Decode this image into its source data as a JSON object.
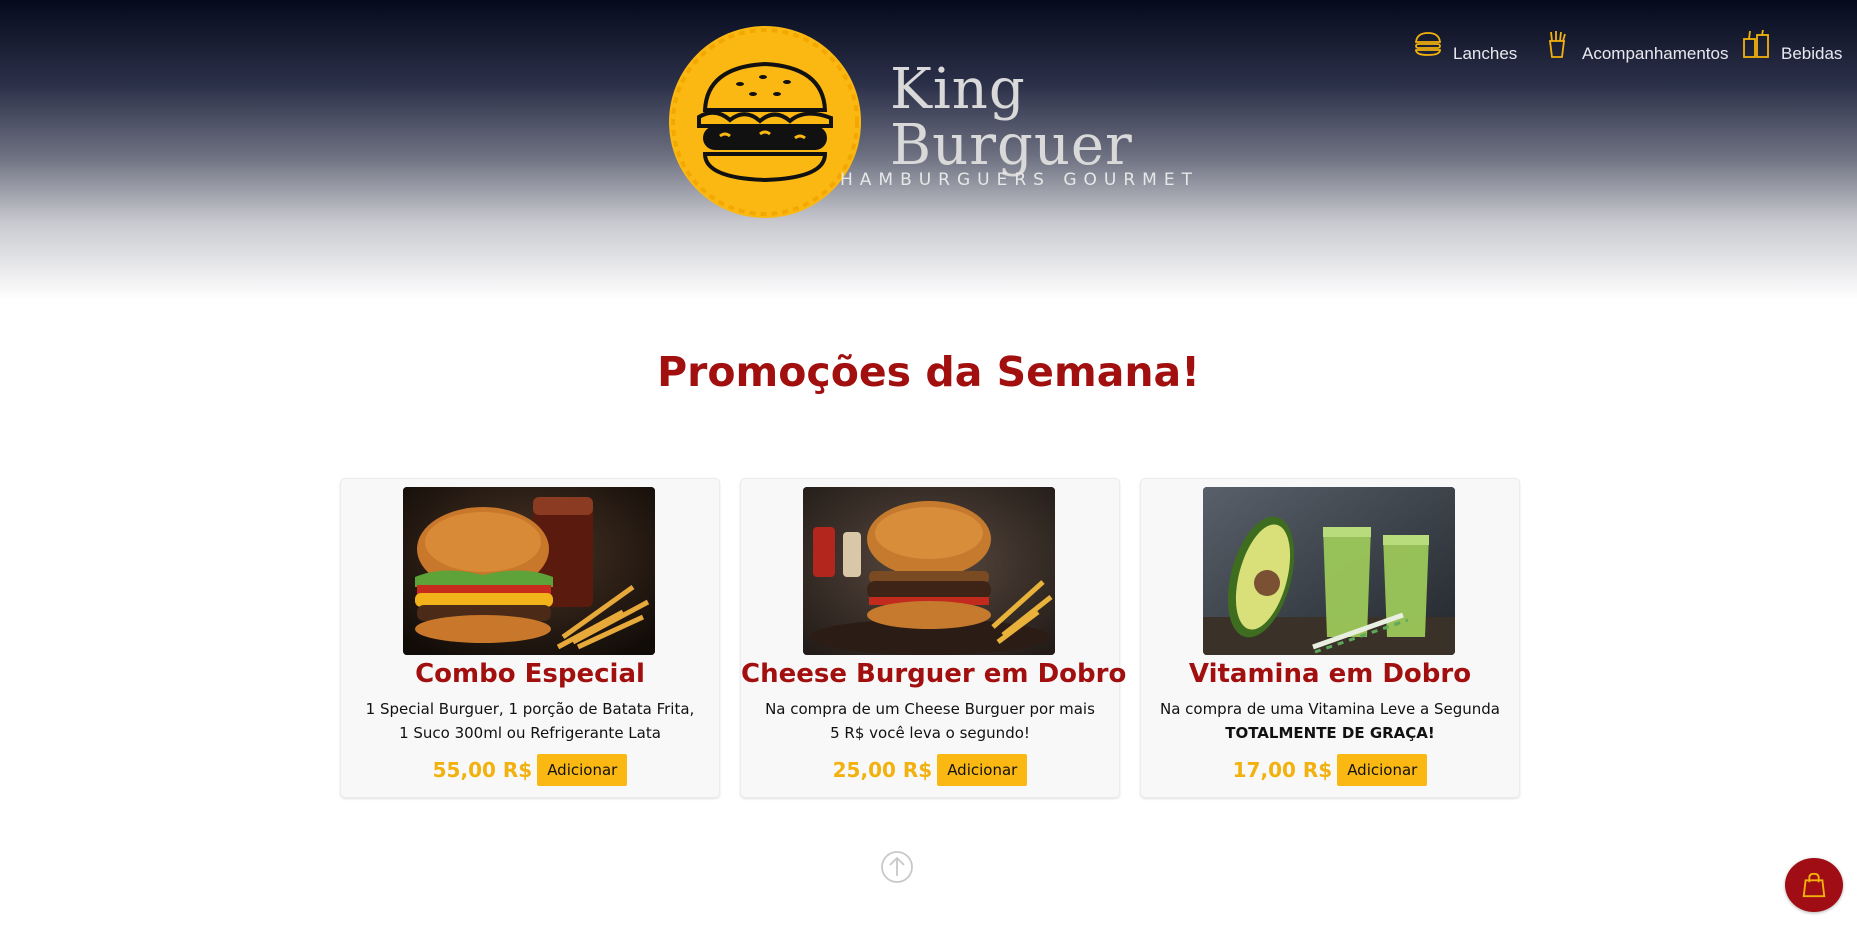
{
  "brand": {
    "name_line1": "King",
    "name_line2": "Burguer",
    "tagline": "HAMBURGUERS GOURMET"
  },
  "nav": {
    "items": [
      {
        "label": "Lanches",
        "icon": "burger-icon"
      },
      {
        "label": "Acompanhamentos",
        "icon": "fries-icon"
      },
      {
        "label": "Bebidas",
        "icon": "drinks-icon"
      }
    ]
  },
  "main": {
    "title": "Promoções da Semana!",
    "promotions": [
      {
        "name": "Combo Especial",
        "description": "1 Special Burguer, 1 porção de Batata Frita, 1 Suco 300ml ou Refrigerante Lata",
        "price": "55,00 R$",
        "button": "Adicionar"
      },
      {
        "name": "Cheese Burguer em Dobro",
        "description": "Na compra de um Cheese Burguer por mais 5 R$ você leva o segundo!",
        "price": "25,00 R$",
        "button": "Adicionar"
      },
      {
        "name": "Vitamina em Dobro",
        "description": "Na compra de uma Vitamina Leve a Segunda",
        "description_bold": "TOTALMENTE DE GRAÇA!",
        "price": "17,00 R$",
        "button": "Adicionar"
      }
    ]
  },
  "controls": {
    "scroll_top_icon": "arrow-up-circle-icon",
    "cart_icon": "shopping-bag-icon"
  },
  "colors": {
    "accent_red": "#a20f0f",
    "accent_yellow": "#fbb813",
    "price_yellow": "#f2b10d",
    "header_dark": "#050a1c"
  }
}
